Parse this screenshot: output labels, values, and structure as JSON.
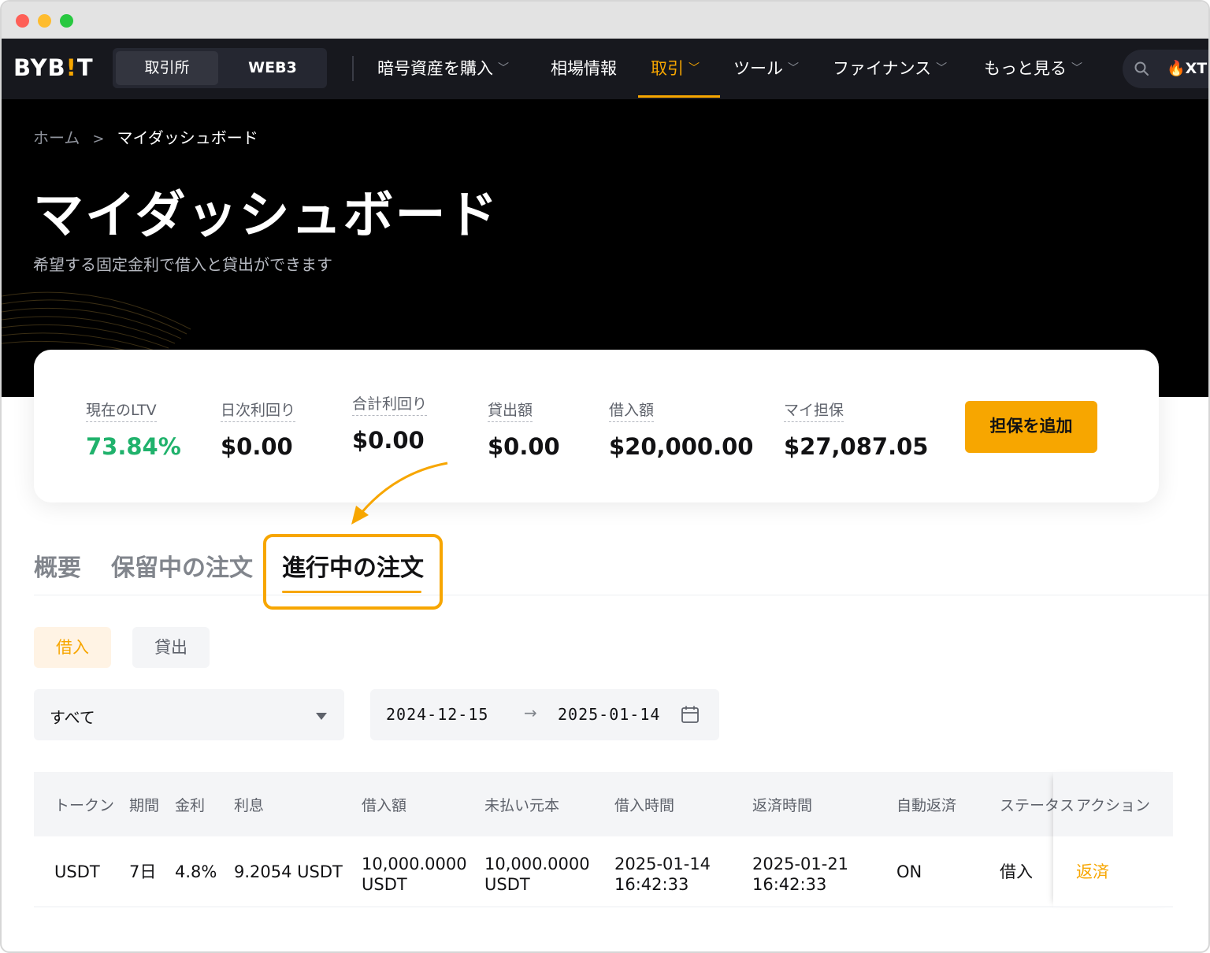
{
  "nav": {
    "logo_main": "BYB",
    "logo_bang": "!",
    "logo_end": "T",
    "segments": [
      "取引所",
      "WEB3"
    ],
    "items": [
      {
        "label": "暗号資産を購入",
        "chevron": true
      },
      {
        "label": "相場情報",
        "chevron": false
      },
      {
        "label": "取引",
        "chevron": true,
        "active": true
      },
      {
        "label": "ツール",
        "chevron": true
      },
      {
        "label": "ファイナンス",
        "chevron": true
      },
      {
        "label": "もっと見る",
        "chevron": true
      }
    ],
    "search_extra": "🔥XTE"
  },
  "breadcrumb": {
    "home": "ホーム",
    "separator": ">",
    "current": "マイダッシュボード"
  },
  "hero": {
    "title": "マイダッシュボード",
    "subtitle": "希望する固定金利で借入と貸出ができます"
  },
  "stats": [
    {
      "label": "現在のLTV",
      "value": "73.84%"
    },
    {
      "label": "日次利回り",
      "value": "$0.00"
    },
    {
      "label": "合計利回り",
      "value": "$0.00"
    },
    {
      "label": "貸出額",
      "value": "$0.00"
    },
    {
      "label": "借入額",
      "value": "$20,000.00"
    },
    {
      "label": "マイ担保",
      "value": "$27,087.05"
    }
  ],
  "add_collateral": "担保を追加",
  "tabs": [
    "概要",
    "保留中の注文",
    "進行中の注文"
  ],
  "sub_tabs": [
    "借入",
    "貸出"
  ],
  "filter": {
    "select_value": "すべて",
    "date_start": "2024-12-15",
    "date_arrow": "→",
    "date_end": "2025-01-14"
  },
  "table": {
    "headers": [
      "トークン",
      "期間",
      "金利",
      "利息",
      "借入額",
      "未払い元本",
      "借入時間",
      "返済時間",
      "自動返済",
      "ステータス",
      "アクション"
    ],
    "row": {
      "token": "USDT",
      "term": "7日",
      "rate": "4.8%",
      "interest": "9.2054 USDT",
      "borrow_amount_1": "10,000.0000",
      "borrow_amount_2": "USDT",
      "principal_1": "10,000.0000",
      "principal_2": "USDT",
      "borrow_time_1": "2025-01-14",
      "borrow_time_2": "16:42:33",
      "repay_time_1": "2025-01-21",
      "repay_time_2": "16:42:33",
      "auto_repay": "ON",
      "status": "借入",
      "action": "返済"
    }
  },
  "colors": {
    "accent": "#f7a600",
    "green": "#20b26c",
    "nav_bg": "#17181e"
  }
}
